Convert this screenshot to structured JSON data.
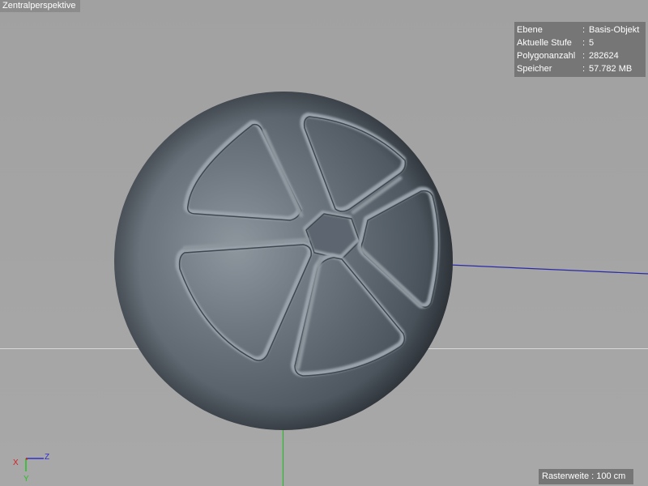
{
  "viewport": {
    "label": "Zentralperspektive"
  },
  "info_panel": {
    "rows": [
      {
        "key": "Ebene",
        "sep": ":",
        "value": "Basis-Objekt"
      },
      {
        "key": "Aktuelle Stufe",
        "sep": ":",
        "value": "5"
      },
      {
        "key": "Polygonanzahl",
        "sep": ":",
        "value": "282624"
      },
      {
        "key": "Speicher",
        "sep": ":",
        "value": "57.782 MB"
      }
    ]
  },
  "grid_info": {
    "text": "Rasterweite : 100 cm"
  },
  "axes": {
    "x_label": "X",
    "y_label": "Y",
    "z_label": "Z",
    "x_color": "#d42020",
    "y_color": "#22c322",
    "z_color": "#2f2fd0"
  },
  "colors": {
    "background": "#a4a4a4",
    "sphere_base": "#57616b",
    "horizon_line": "#d9d9d9"
  }
}
